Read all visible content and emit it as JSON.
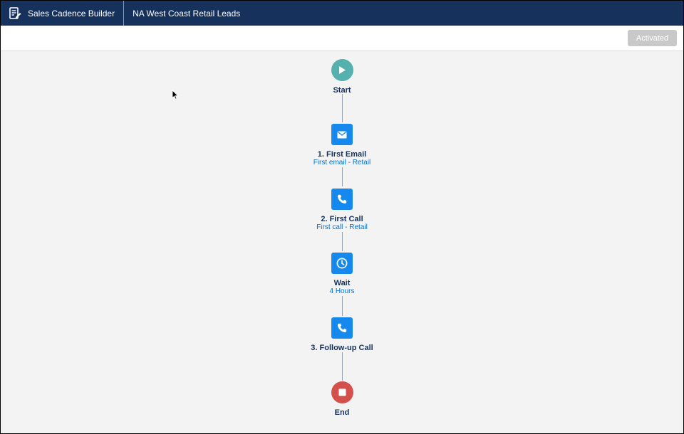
{
  "header": {
    "app_name": "Sales Cadence Builder",
    "record_name": "NA West Coast Retail Leads"
  },
  "toolbar": {
    "activated_label": "Activated"
  },
  "flow": {
    "start": {
      "label": "Start",
      "icon": "play-icon"
    },
    "steps": [
      {
        "label": "1. First Email",
        "subtitle": "First email - Retail",
        "icon": "email-icon"
      },
      {
        "label": "2. First Call",
        "subtitle": "First call - Retail",
        "icon": "phone-icon"
      },
      {
        "label": "Wait",
        "subtitle": "4 Hours",
        "icon": "clock-icon"
      },
      {
        "label": "3. Follow-up Call",
        "subtitle": "",
        "icon": "phone-icon"
      }
    ],
    "end": {
      "label": "End",
      "icon": "stop-icon"
    }
  },
  "colors": {
    "header_bg": "#16325c",
    "start": "#54b1ae",
    "step": "#1589ee",
    "end": "#d4504c",
    "link": "#0070d2"
  }
}
